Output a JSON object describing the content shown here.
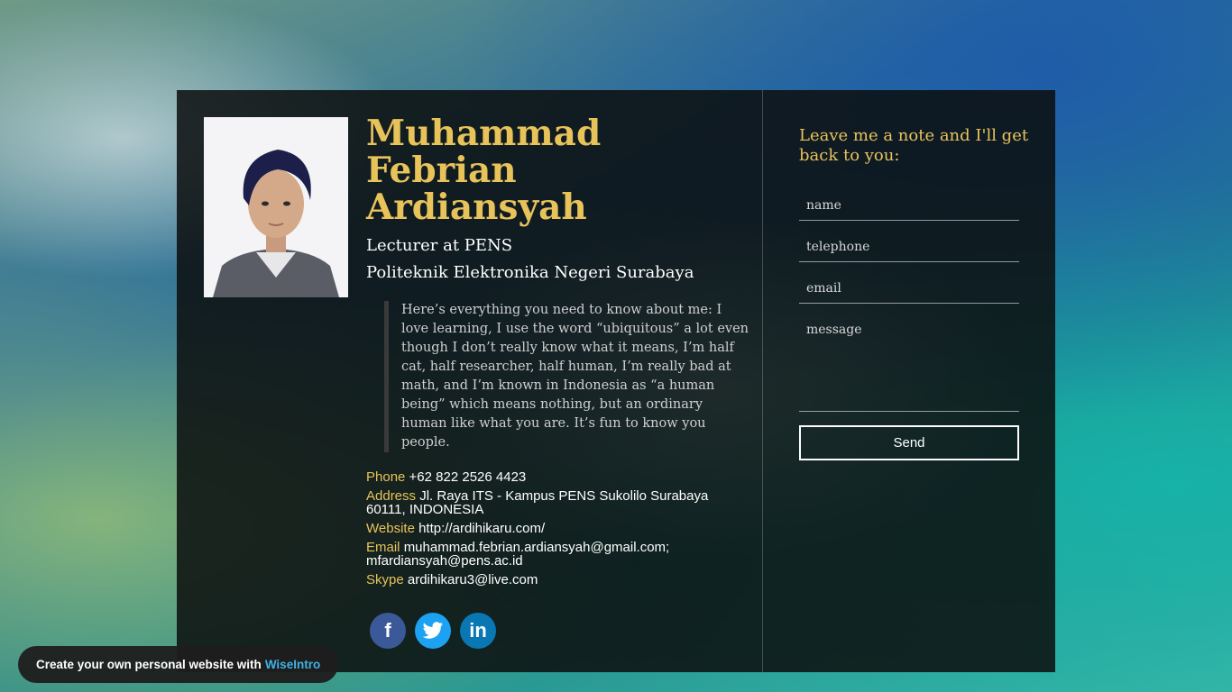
{
  "profile": {
    "name": "Muhammad Febrian Ardiansyah",
    "position": "Lecturer at PENS",
    "institution": "Politeknik Elektronika Negeri Surabaya",
    "bio": "Here’s everything you need to know about me: I love learning, I use the word “ubiquitous” a lot even though I don’t really know what it means, I’m half cat, half researcher, half human, I’m really bad at math, and I’m known in Indonesia as “a human being” which means nothing, but an ordinary human like what you are. It’s fun to know you people."
  },
  "contacts": [
    {
      "label": "Phone",
      "value": "+62 822 2526 4423"
    },
    {
      "label": "Address",
      "value": "Jl. Raya ITS - Kampus PENS Sukolilo Surabaya 60111, INDONESIA"
    },
    {
      "label": "Website",
      "value": "http://ardihikaru.com/"
    },
    {
      "label": "Email",
      "value": "muhammad.febrian.ardiansyah@gmail.com; mfardiansyah@pens.ac.id"
    },
    {
      "label": "Skype",
      "value": "ardihikaru3@live.com"
    }
  ],
  "social": {
    "facebook": "f",
    "twitter": "t",
    "linkedin": "in"
  },
  "form": {
    "title": "Leave me a note and I'll get back to you:",
    "name_placeholder": "name",
    "telephone_placeholder": "telephone",
    "email_placeholder": "email",
    "message_placeholder": "message",
    "send_label": "Send"
  },
  "promo": {
    "text": "Create your own personal website with",
    "link": "WiseIntro"
  },
  "colors": {
    "accent": "#e8c35a",
    "card": "#0c0e0e",
    "facebook": "#3b5998",
    "twitter": "#1da1f2",
    "linkedin": "#0a77b5",
    "link": "#3fb2e6"
  },
  "icons": {
    "facebook": "facebook-icon",
    "twitter": "twitter-icon",
    "linkedin": "linkedin-icon"
  }
}
